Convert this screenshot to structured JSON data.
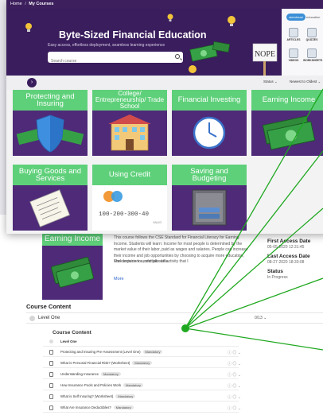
{
  "breadcrumb": {
    "home": "Home",
    "separator": "/",
    "current": "My Courses"
  },
  "hero": {
    "title": "Byte-Sized Financial Education",
    "subtitle": "Easy access, effortless deployment, seamless learning experience",
    "search_placeholder": "Search course",
    "sign_text": "NOPE"
  },
  "brand": {
    "logo_text": "stemhead",
    "logo_suffix": "education"
  },
  "resources": [
    {
      "label": "ARTICLES",
      "icon": "article-icon"
    },
    {
      "label": "QUIZZES",
      "icon": "quiz-icon"
    },
    {
      "label": "VIDEOS",
      "icon": "video-icon"
    },
    {
      "label": "WORKSHEETS",
      "icon": "worksheet-icon"
    }
  ],
  "filters": {
    "status_label": "Status",
    "sort_label": "Newest to Oldest"
  },
  "courses": [
    {
      "title": "Protecting and Insuring",
      "icon": "shield-icon"
    },
    {
      "title": "College/ Entrepreneurship/ Trade School",
      "icon": "school-icon"
    },
    {
      "title": "Financial Investing",
      "icon": "clock-icon"
    },
    {
      "title": "Earning Income",
      "icon": "money-icon"
    },
    {
      "title": "Buying Goods and Services",
      "icon": "receipt-icon"
    },
    {
      "title": "Using Credit",
      "icon": "credit-card-icon"
    },
    {
      "title": "Saving and Budgeting",
      "icon": "safe-icon"
    }
  ],
  "credit_card_number": "100-200-300-40",
  "detail": {
    "card_title": "Earning Income",
    "description": "This course follows the CSE Standard for Financial Literacy for Earning Income. Students will learn: Income for most people is determined by the market value of their labor, paid as wages and salaries. People can increase their income and job opportunities by choosing to acquire more education, work experience, and job skills.",
    "description2": "The decision to undertake an activity that I",
    "more": "More",
    "first_access_label": "First Access Date",
    "first_access_value": "05-05-2020 12:31:45",
    "last_access_label": "Last Access Date",
    "last_access_value": "08-27-2020 18:30:08",
    "status_label": "Status",
    "status_value": "In Progress"
  },
  "course_content": {
    "title": "Course Content",
    "level_name": "Level One",
    "level_count": "0/13",
    "inner_title": "Course Content",
    "inner_level": "Level One",
    "items": [
      {
        "label": "Protecting and Insuring Pre-Assessment (Level One)",
        "badge": "Mandatory"
      },
      {
        "label": "What is Personal Financial Risk? (Worksheet)",
        "badge": "Mandatory"
      },
      {
        "label": "Understanding Insurance",
        "badge": "Mandatory"
      },
      {
        "label": "How Insurance Pools and Policies Work",
        "badge": "Mandatory"
      },
      {
        "label": "What is Self Insuring? (Worksheet)",
        "badge": "Mandatory"
      },
      {
        "label": "What Are Insurance Deductibles?",
        "badge": "Mandatory"
      }
    ]
  },
  "colors": {
    "primary_purple": "#3a1d5d",
    "card_purple": "#4e2a78",
    "accent_green": "#5fd07a",
    "annotation_line": "#1fa81f"
  }
}
